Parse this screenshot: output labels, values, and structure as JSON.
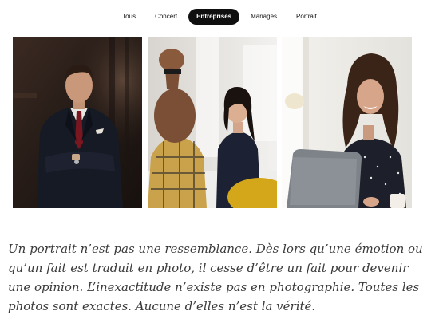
{
  "nav": {
    "tabs": [
      {
        "label": "Tous"
      },
      {
        "label": "Concert"
      },
      {
        "label": "Entreprises"
      },
      {
        "label": "Mariages"
      },
      {
        "label": "Portrait"
      }
    ],
    "active_tab": "Entreprises"
  },
  "gallery": {
    "photos": [
      {
        "subject": "man in dark suit with red tie, arms crossed"
      },
      {
        "subject": "women laughing at a meeting table"
      },
      {
        "subject": "woman with curly hair laughing at a laptop"
      }
    ]
  },
  "quote": {
    "text": "Un portrait n’est pas une ressemblance. Dès lors qu’une émotion ou qu’un fait est traduit en photo, il cesse d’être un fait pour devenir une opinion. L’inexactitude n’existe pas en photographie. Toutes les photos sont exactes. Aucune d’elles n’est la vérité."
  },
  "colors": {
    "active_tab_bg": "#0f0f0f",
    "quote_text": "#3a3a3a"
  }
}
